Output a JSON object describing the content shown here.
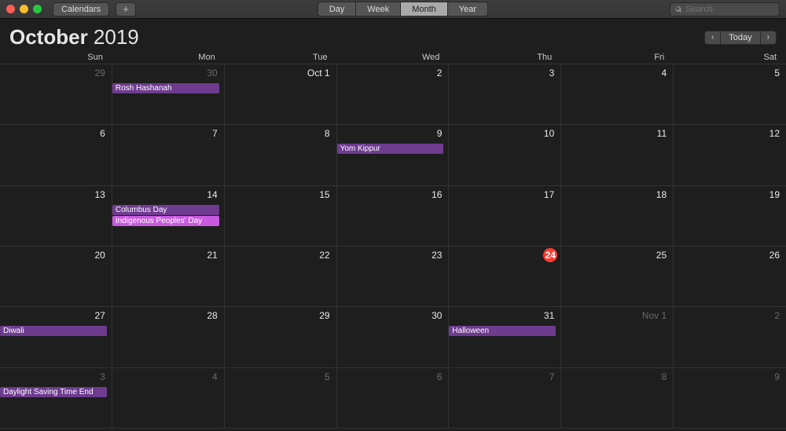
{
  "toolbar": {
    "calendars_label": "Calendars",
    "add_label": "+",
    "views": {
      "day": "Day",
      "week": "Week",
      "month": "Month",
      "year": "Year",
      "active": "month"
    },
    "search_placeholder": "Search"
  },
  "header": {
    "month": "October",
    "year": "2019",
    "prev": "‹",
    "today": "Today",
    "next": "›"
  },
  "weekdays": [
    "Sun",
    "Mon",
    "Tue",
    "Wed",
    "Thu",
    "Fri",
    "Sat"
  ],
  "colors": {
    "holiday1": "#6e3c8f",
    "holiday2": "#c95adf",
    "today": "#ff3b30"
  },
  "cells": [
    {
      "label": "29",
      "muted": true,
      "events": []
    },
    {
      "label": "30",
      "muted": true,
      "events": [
        {
          "title": "Rosh Hashanah",
          "color": "holiday1"
        }
      ]
    },
    {
      "label": "Oct 1",
      "muted": false,
      "events": []
    },
    {
      "label": "2",
      "muted": false,
      "events": []
    },
    {
      "label": "3",
      "muted": false,
      "events": []
    },
    {
      "label": "4",
      "muted": false,
      "events": []
    },
    {
      "label": "5",
      "muted": false,
      "events": []
    },
    {
      "label": "6",
      "muted": false,
      "events": []
    },
    {
      "label": "7",
      "muted": false,
      "events": []
    },
    {
      "label": "8",
      "muted": false,
      "events": []
    },
    {
      "label": "9",
      "muted": false,
      "events": [
        {
          "title": "Yom Kippur",
          "color": "holiday1"
        }
      ]
    },
    {
      "label": "10",
      "muted": false,
      "events": []
    },
    {
      "label": "11",
      "muted": false,
      "events": []
    },
    {
      "label": "12",
      "muted": false,
      "events": []
    },
    {
      "label": "13",
      "muted": false,
      "events": []
    },
    {
      "label": "14",
      "muted": false,
      "events": [
        {
          "title": "Columbus Day",
          "color": "holiday1"
        },
        {
          "title": "Indigenous Peoples' Day",
          "color": "holiday2"
        }
      ]
    },
    {
      "label": "15",
      "muted": false,
      "events": []
    },
    {
      "label": "16",
      "muted": false,
      "events": []
    },
    {
      "label": "17",
      "muted": false,
      "events": []
    },
    {
      "label": "18",
      "muted": false,
      "events": []
    },
    {
      "label": "19",
      "muted": false,
      "events": []
    },
    {
      "label": "20",
      "muted": false,
      "events": []
    },
    {
      "label": "21",
      "muted": false,
      "events": []
    },
    {
      "label": "22",
      "muted": false,
      "events": []
    },
    {
      "label": "23",
      "muted": false,
      "events": []
    },
    {
      "label": "24",
      "muted": false,
      "today": true,
      "events": []
    },
    {
      "label": "25",
      "muted": false,
      "events": []
    },
    {
      "label": "26",
      "muted": false,
      "events": []
    },
    {
      "label": "27",
      "muted": false,
      "events": [
        {
          "title": "Diwali",
          "color": "holiday1"
        }
      ]
    },
    {
      "label": "28",
      "muted": false,
      "events": []
    },
    {
      "label": "29",
      "muted": false,
      "events": []
    },
    {
      "label": "30",
      "muted": false,
      "events": []
    },
    {
      "label": "31",
      "muted": false,
      "events": [
        {
          "title": "Halloween",
          "color": "holiday1"
        }
      ]
    },
    {
      "label": "Nov 1",
      "muted": true,
      "events": []
    },
    {
      "label": "2",
      "muted": true,
      "events": []
    },
    {
      "label": "3",
      "muted": true,
      "events": [
        {
          "title": "Daylight Saving Time End",
          "color": "holiday1"
        }
      ]
    },
    {
      "label": "4",
      "muted": true,
      "events": []
    },
    {
      "label": "5",
      "muted": true,
      "events": []
    },
    {
      "label": "6",
      "muted": true,
      "events": []
    },
    {
      "label": "7",
      "muted": true,
      "events": []
    },
    {
      "label": "8",
      "muted": true,
      "events": []
    },
    {
      "label": "9",
      "muted": true,
      "events": []
    }
  ]
}
